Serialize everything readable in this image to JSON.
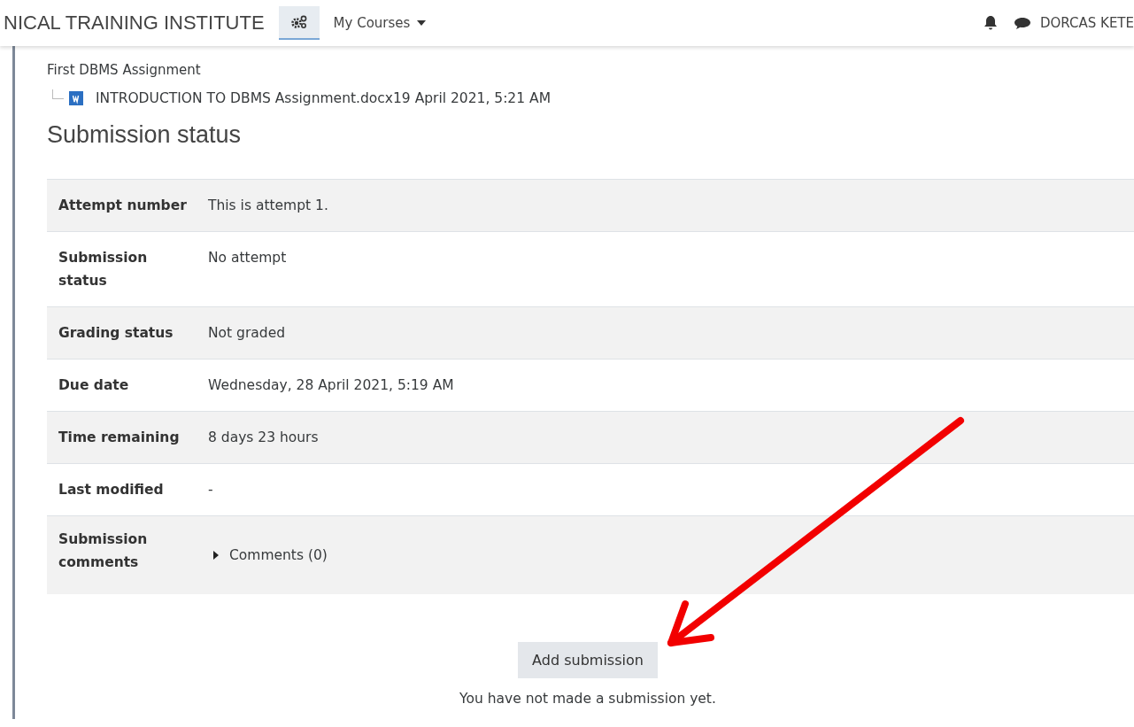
{
  "header": {
    "site_name": "NICAL TRAINING INSTITUTE",
    "menu": {
      "label": "My Courses"
    },
    "user_name": "DORCAS KETE"
  },
  "assignment": {
    "title": "First DBMS Assignment",
    "file": {
      "name": "INTRODUCTION TO DBMS Assignment.docx",
      "date": "19 April 2021, 5:21 AM"
    }
  },
  "section_title": "Submission status",
  "status_rows": [
    {
      "kind": "text",
      "label": "Attempt number",
      "value": "This is attempt 1."
    },
    {
      "kind": "text",
      "label": "Submission status",
      "value": "No attempt"
    },
    {
      "kind": "text",
      "label": "Grading status",
      "value": "Not graded"
    },
    {
      "kind": "text",
      "label": "Due date",
      "value": "Wednesday, 28 April 2021, 5:19 AM"
    },
    {
      "kind": "text",
      "label": "Time remaining",
      "value": "8 days 23 hours"
    },
    {
      "kind": "text",
      "label": "Last modified",
      "value": "-"
    },
    {
      "kind": "comments",
      "label": "Submission comments",
      "value": "Comments (0)",
      "expanded": false
    }
  ],
  "add_button": "Add submission",
  "note": "You have not made a submission yet."
}
